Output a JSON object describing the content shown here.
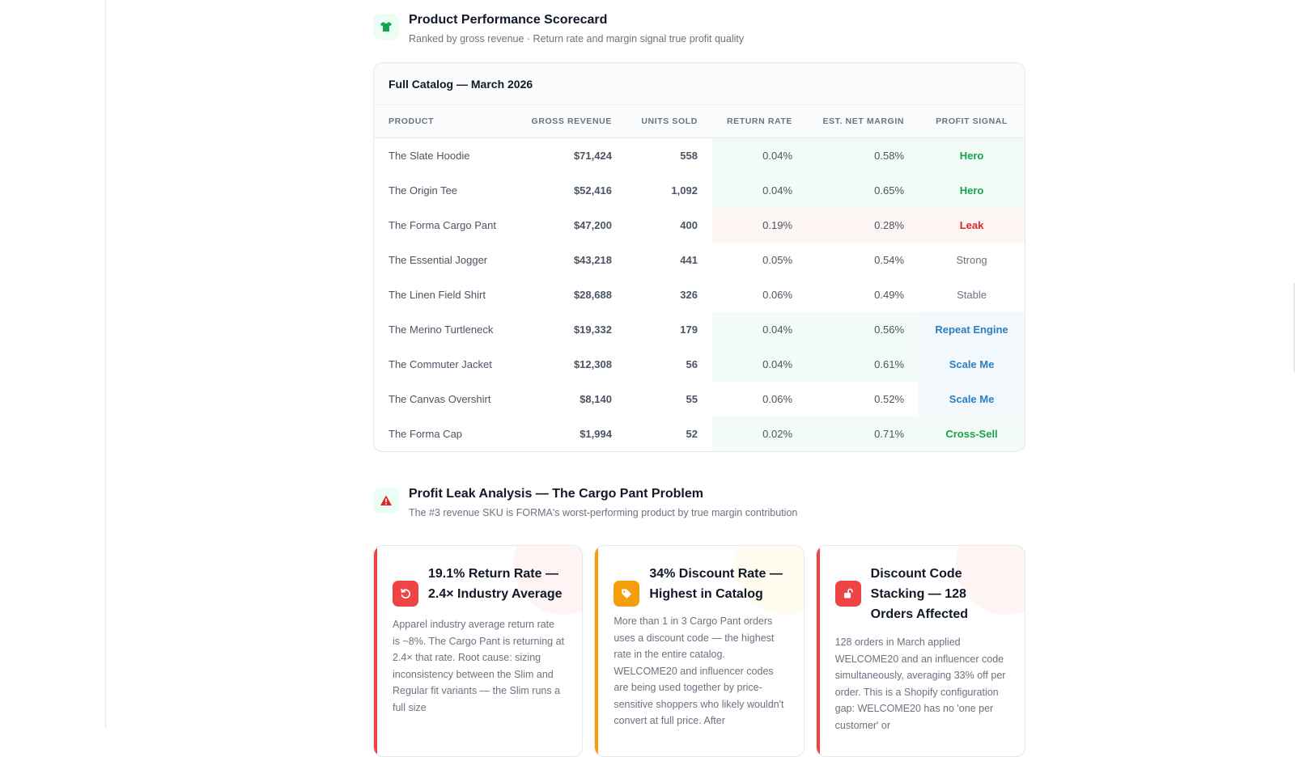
{
  "scorecard": {
    "title": "Product Performance Scorecard",
    "subtitle": "Ranked by gross revenue · Return rate and margin signal true profit quality",
    "icon": "shirt-icon",
    "card_title": "Full Catalog — March 2026",
    "columns": [
      "PRODUCT",
      "GROSS REVENUE",
      "UNITS SOLD",
      "RETURN RATE",
      "EST. NET MARGIN",
      "PROFIT SIGNAL"
    ],
    "rows": [
      {
        "product": "The Slate Hoodie",
        "revenue": "$71,424",
        "units": "558",
        "return_rate": "0.04%",
        "margin": "0.58%",
        "signal": "Hero"
      },
      {
        "product": "The Origin Tee",
        "revenue": "$52,416",
        "units": "1,092",
        "return_rate": "0.04%",
        "margin": "0.65%",
        "signal": "Hero"
      },
      {
        "product": "The Forma Cargo Pant",
        "revenue": "$47,200",
        "units": "400",
        "return_rate": "0.19%",
        "margin": "0.28%",
        "signal": "Leak"
      },
      {
        "product": "The Essential Jogger",
        "revenue": "$43,218",
        "units": "441",
        "return_rate": "0.05%",
        "margin": "0.54%",
        "signal": "Strong"
      },
      {
        "product": "The Linen Field Shirt",
        "revenue": "$28,688",
        "units": "326",
        "return_rate": "0.06%",
        "margin": "0.49%",
        "signal": "Stable"
      },
      {
        "product": "The Merino Turtleneck",
        "revenue": "$19,332",
        "units": "179",
        "return_rate": "0.04%",
        "margin": "0.56%",
        "signal": "Repeat Engine"
      },
      {
        "product": "The Commuter Jacket",
        "revenue": "$12,308",
        "units": "56",
        "return_rate": "0.04%",
        "margin": "0.61%",
        "signal": "Scale Me"
      },
      {
        "product": "The Canvas Overshirt",
        "revenue": "$8,140",
        "units": "55",
        "return_rate": "0.06%",
        "margin": "0.52%",
        "signal": "Scale Me"
      },
      {
        "product": "The Forma Cap",
        "revenue": "$1,994",
        "units": "52",
        "return_rate": "0.02%",
        "margin": "0.71%",
        "signal": "Cross-Sell"
      }
    ]
  },
  "leak": {
    "title": "Profit Leak Analysis — The Cargo Pant Problem",
    "subtitle": "The #3 revenue SKU is FORMA's worst-performing product by true margin contribution",
    "icon": "warning-icon",
    "cards": [
      {
        "icon": "return-arrow-icon",
        "accent": "#ef4444",
        "title": "19.1% Return Rate — 2.4× Industry Average",
        "body": "Apparel industry average return rate is ~8%. The Cargo Pant is returning at 2.4× that rate. Root cause: sizing inconsistency between the Slim and Regular fit variants — the Slim runs a full size"
      },
      {
        "icon": "tag-icon",
        "accent": "#f59e0b",
        "title": "34% Discount Rate — Highest in Catalog",
        "body": "More than 1 in 3 Cargo Pant orders uses a discount code — the highest rate in the entire catalog. WELCOME20 and influencer codes are being used together by price-sensitive shoppers who likely wouldn't convert at full price. After"
      },
      {
        "icon": "unlock-icon",
        "accent": "#ef4444",
        "title": "Discount Code Stacking — 128 Orders Affected",
        "body": "128 orders in March applied WELCOME20 and an influencer code simultaneously, averaging 33% off per order. This is a Shopify configuration gap: WELCOME20 has no 'one per customer' or"
      }
    ]
  },
  "colors": {
    "green": "#16a34a",
    "red": "#dc2626",
    "blue": "#2a7fc2",
    "amber": "#f59e0b"
  }
}
